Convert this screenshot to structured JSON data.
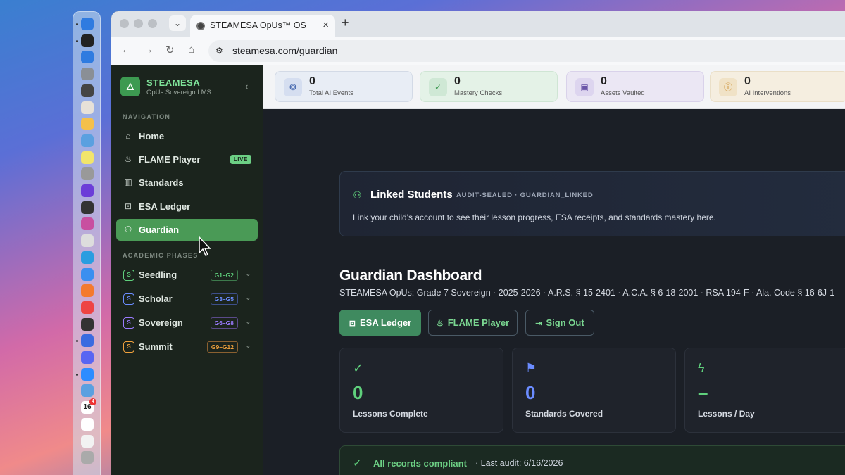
{
  "browser": {
    "tab_title": "STEAMESA OpUs™ OS",
    "url": "steamesa.com/guardian"
  },
  "dock": {
    "calendar_date": "16",
    "calendar_badge": "4",
    "icons": [
      "finder-icon",
      "terminal-icon",
      "app-store-icon",
      "settings-icon",
      "calculator-icon",
      "paint-icon",
      "photos-icon",
      "maps-icon",
      "notes-icon",
      "screenshot-icon",
      "imovie-icon",
      "davinci-icon",
      "app-icon",
      "app-icon",
      "canva-icon",
      "safari-icon",
      "soundcloud-icon",
      "chrome-icon",
      "app-icon",
      "app-icon",
      "discord-icon",
      "zoom-icon",
      "mail-icon",
      "calendar-icon",
      "cal-icon",
      "list-icon",
      "avatar-icon"
    ]
  },
  "sidebar": {
    "brand": "STEAMESA",
    "brand_sub": "OpUs Sovereign LMS",
    "nav_section": "NAVIGATION",
    "nav": [
      {
        "label": "Home",
        "icon": "home-icon"
      },
      {
        "label": "FLAME Player",
        "icon": "flame-icon",
        "badge": "LIVE"
      },
      {
        "label": "Standards",
        "icon": "books-icon"
      },
      {
        "label": "ESA Ledger",
        "icon": "lock-icon"
      },
      {
        "label": "Guardian",
        "icon": "users-icon",
        "active": true
      }
    ],
    "phases_section": "ACADEMIC PHASES",
    "phases": [
      {
        "label": "Seedling",
        "grades": "G1–G2",
        "initial": "S",
        "color": "#5fd07c"
      },
      {
        "label": "Scholar",
        "grades": "G3–G5",
        "initial": "S",
        "color": "#6b8cff"
      },
      {
        "label": "Sovereign",
        "grades": "G6–G8",
        "initial": "S",
        "color": "#9b7bff"
      },
      {
        "label": "Summit",
        "grades": "G9–G12",
        "initial": "S",
        "color": "#f0a13c"
      }
    ]
  },
  "stats": [
    {
      "value": "0",
      "label": "Total AI Events",
      "icon": "brain-icon"
    },
    {
      "value": "0",
      "label": "Mastery Checks",
      "icon": "check-circle-icon"
    },
    {
      "value": "0",
      "label": "Assets Vaulted",
      "icon": "image-icon"
    },
    {
      "value": "0",
      "label": "AI Interventions",
      "icon": "alert-icon"
    }
  ],
  "linked": {
    "title": "Linked Students",
    "tag": "AUDIT-SEALED · GUARDIAN_LINKED",
    "description": "Link your child's account to see their lesson progress, ESA receipts, and standards mastery here."
  },
  "dashboard": {
    "title": "Guardian Dashboard",
    "subtitle": "STEAMESA OpUs: Grade 7 Sovereign · 2025-2026 · A.R.S. § 15-2401 · A.C.A. § 6-18-2001 · RSA 194-F · Ala. Code § 16-6J-1",
    "buttons": {
      "esa_ledger": "ESA Ledger",
      "flame_player": "FLAME Player",
      "sign_out": "Sign Out"
    },
    "cards": [
      {
        "value": "0",
        "label": "Lessons Complete",
        "icon": "check-circle-icon",
        "color": "#5fd07c"
      },
      {
        "value": "0",
        "label": "Standards Covered",
        "icon": "flag-icon",
        "color": "#6b8cff"
      },
      {
        "value": "–",
        "label": "Lessons / Day",
        "icon": "bolt-icon",
        "color": "#5fd07c"
      }
    ]
  },
  "compliance": {
    "title": "All records compliant",
    "audit": "· Last audit: 6/16/2026"
  }
}
